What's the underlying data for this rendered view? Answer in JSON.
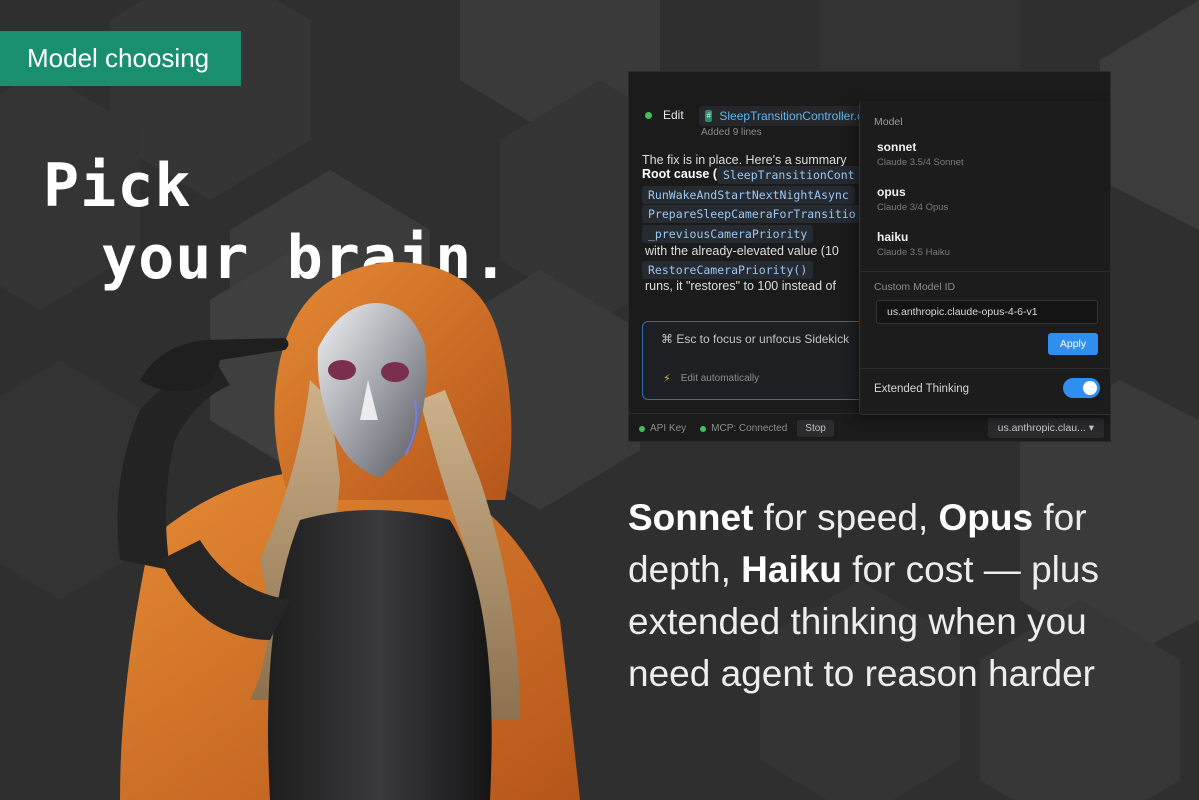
{
  "ribbon": {
    "label": "Model choosing"
  },
  "headline": {
    "line1": "Pick",
    "line2": "your brain."
  },
  "tagline": {
    "sonnet": "Sonnet",
    "t1": " for speed, ",
    "opus": "Opus",
    "t2": " for depth, ",
    "haiku": "Haiku",
    "t3": " for cost — plus extended thinking when you need agent to reason harder"
  },
  "panel": {
    "edit_label": "Edit",
    "file_name": "SleepTransitionController.cs",
    "added": "Added 9 lines",
    "summary": "The fix is in place. Here's a summary",
    "root_cause": "Root cause (",
    "code1": "SleepTransitionCont",
    "code2": "RunWakeAndStartNextNightAsync",
    "code3": "PrepareSleepCameraForTransitio",
    "code4": "_previousCameraPriority",
    "text1": "with the already-elevated value (10",
    "code5": "RestoreCameraPriority()",
    "text2": "runs, it \"restores\" to 100 instead of",
    "input_hint": "⌘ Esc to focus or unfocus Sidekick",
    "edit_auto": "Edit automatically",
    "footer": {
      "api_key": "API Key",
      "mcp": "MCP: Connected",
      "stop": "Stop",
      "model": "us.anthropic.clau... ▾"
    },
    "dropdown": {
      "title": "Model",
      "items": [
        {
          "name": "sonnet",
          "desc": "Claude 3.5/4 Sonnet"
        },
        {
          "name": "opus",
          "desc": "Claude 3/4 Opus"
        },
        {
          "name": "haiku",
          "desc": "Claude 3.5 Haiku"
        }
      ],
      "custom_label": "Custom Model ID",
      "custom_value": "us.anthropic.claude-opus-4-6-v1",
      "apply": "Apply",
      "thinking": "Extended Thinking",
      "thinking_on": true
    }
  },
  "colors": {
    "accent": "#1a8f6f",
    "blue": "#2f8ff0",
    "background": "#2f2f30",
    "hood": "#d9731f"
  }
}
